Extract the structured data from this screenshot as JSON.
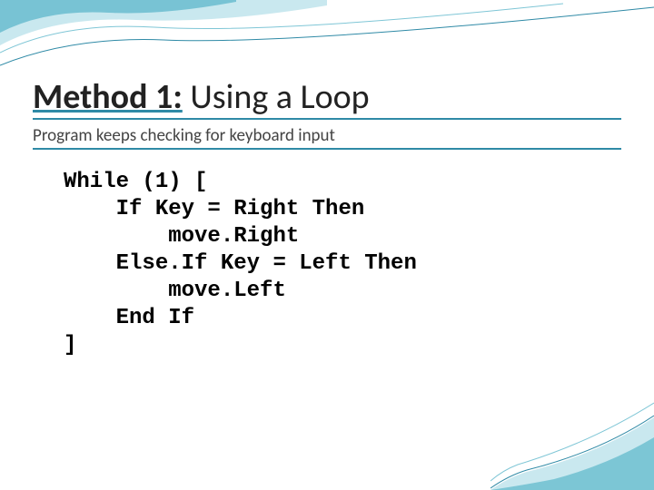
{
  "title": {
    "bold": "Method 1:",
    "rest": " Using a Loop"
  },
  "subtitle": "Program keeps checking for keyboard input",
  "code": {
    "l1": "While (1) [",
    "l2": "    If Key = Right Then",
    "l3": "        move.Right",
    "l4": "    Else.If Key = Left Then",
    "l5": "        move.Left",
    "l6": "    End If",
    "l7": "]"
  }
}
